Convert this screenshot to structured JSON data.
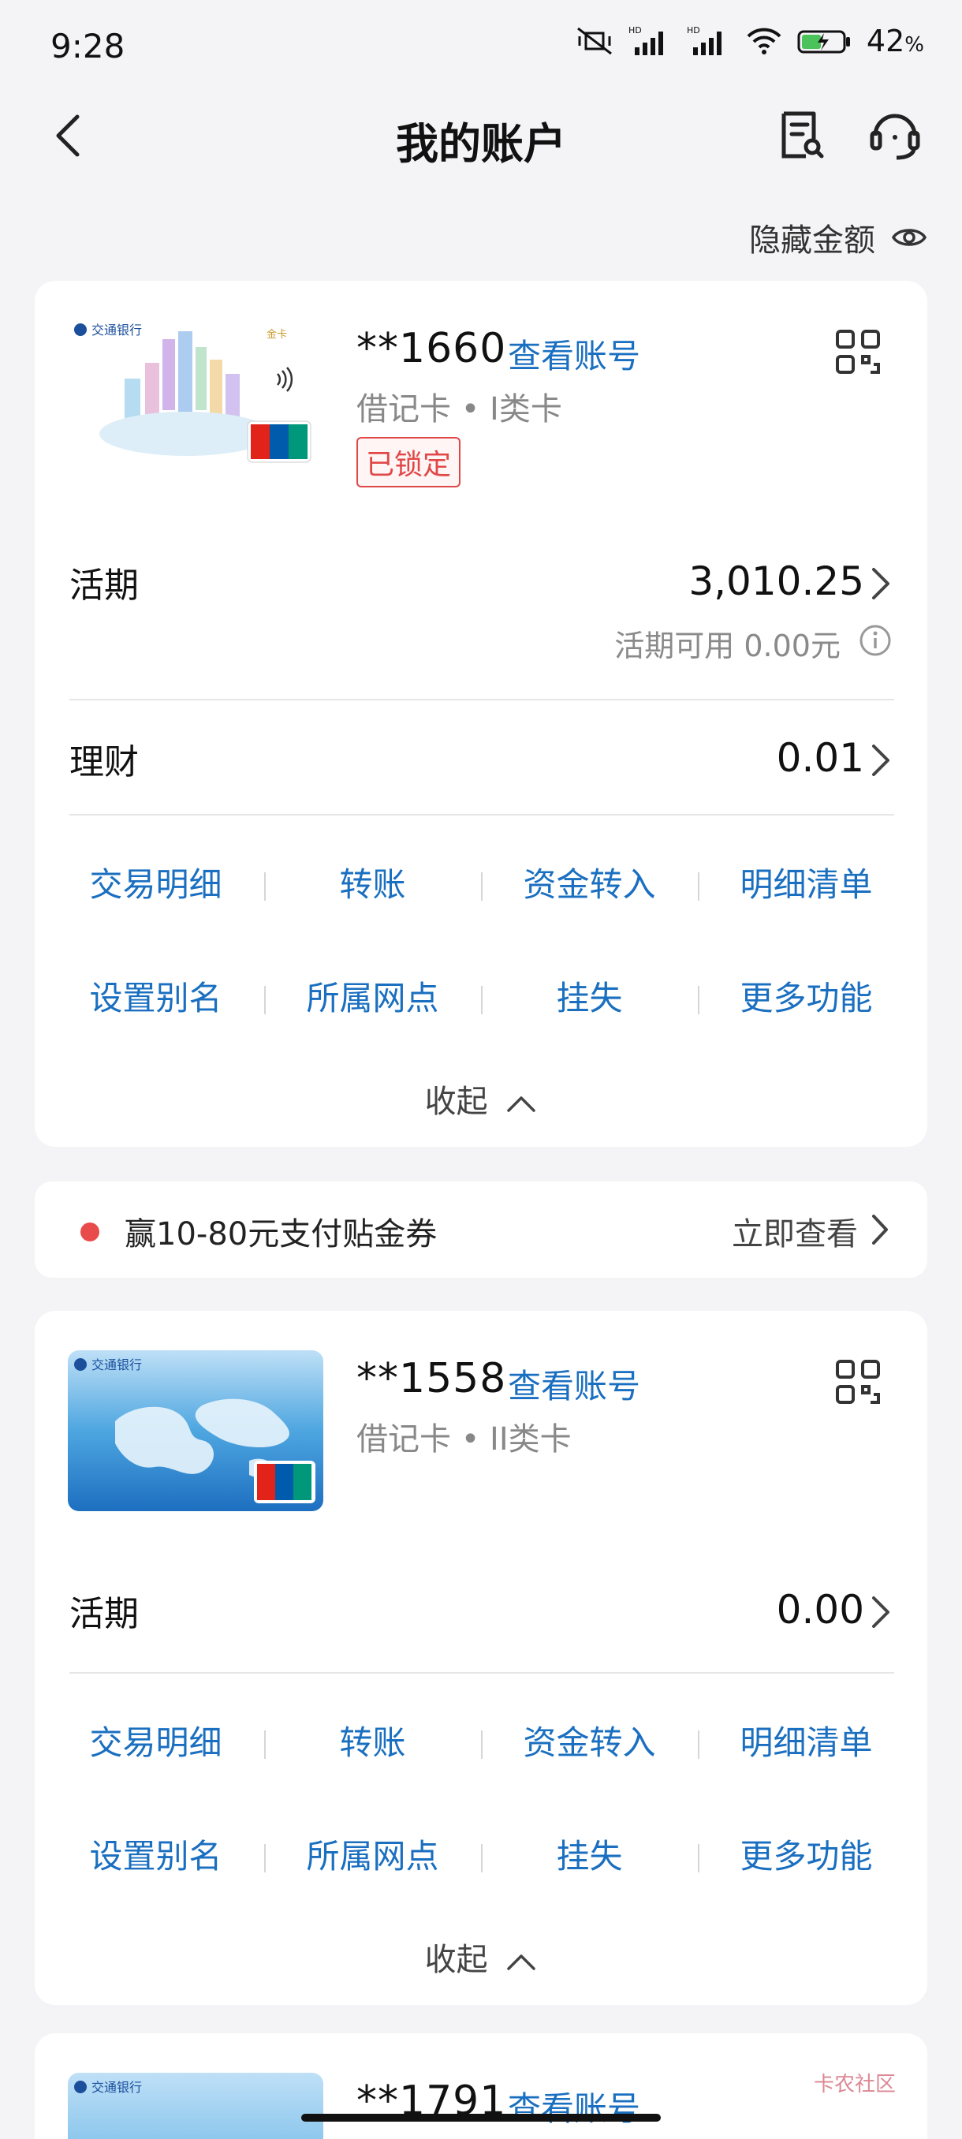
{
  "status_bar": {
    "time": "9:28",
    "battery": "42",
    "battery_unit": "%"
  },
  "header": {
    "title": "我的账户"
  },
  "hide_amount_label": "隐藏金额",
  "accounts": [
    {
      "number": "**1660",
      "view_number_label": "查看账号",
      "card_type": "借记卡 • I类卡",
      "status_badge": "已锁定",
      "image_text": "交通银行",
      "image_sub": "金卡",
      "current_label": "活期",
      "current_balance": "3,010.25",
      "available_label": "活期可用 0.00元",
      "wealth_label": "理财",
      "wealth_balance": "0.01",
      "actions_row1": [
        "交易明细",
        "转账",
        "资金转入",
        "明细清单"
      ],
      "actions_row2": [
        "设置别名",
        "所属网点",
        "挂失",
        "更多功能"
      ],
      "collapse_label": "收起"
    },
    {
      "number": "**1558",
      "view_number_label": "查看账号",
      "card_type": "借记卡 • II类卡",
      "image_text": "交通银行",
      "current_label": "活期",
      "current_balance": "0.00",
      "actions_row1": [
        "交易明细",
        "转账",
        "资金转入",
        "明细清单"
      ],
      "actions_row2": [
        "设置别名",
        "所属网点",
        "挂失",
        "更多功能"
      ],
      "collapse_label": "收起"
    },
    {
      "number": "**1791",
      "view_number_label": "查看账号",
      "image_text": "交通银行"
    }
  ],
  "promo": {
    "text": "赢10-80元支付贴金券",
    "cta": "立即查看"
  },
  "watermark": "卡农社区",
  "colors": {
    "accent": "#1a6fc0",
    "danger": "#e04848",
    "background": "#f4f4f6"
  }
}
